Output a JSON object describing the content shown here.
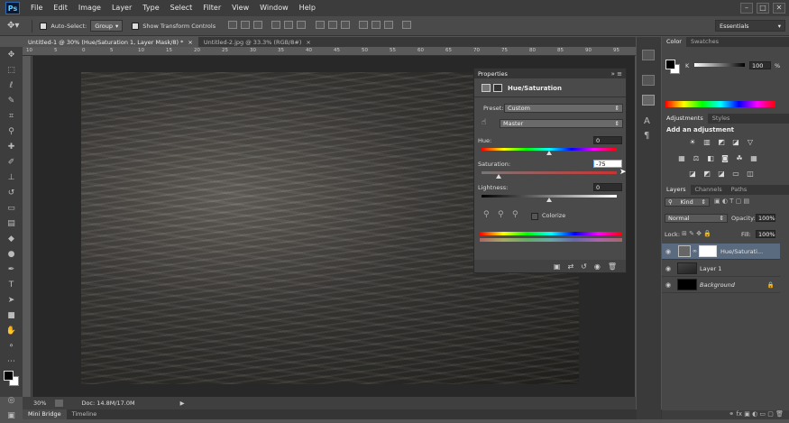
{
  "app": {
    "logo": "Ps",
    "essentials": "Essentials",
    "window_controls": [
      "–",
      "□",
      "✕"
    ]
  },
  "menu": [
    "File",
    "Edit",
    "Image",
    "Layer",
    "Type",
    "Select",
    "Filter",
    "View",
    "Window",
    "Help"
  ],
  "options": {
    "auto_select_label": "Auto-Select:",
    "auto_select_value": "Group",
    "transform_label": "Show Transform Controls"
  },
  "tabs": [
    {
      "label": "Untitled-1 @ 30% (Hue/Saturation 1, Layer Mask/8) *",
      "close": "×"
    },
    {
      "label": "Untitled-2.jpg @ 33.3% (RGB/8#)",
      "close": "×"
    }
  ],
  "ruler_marks": [
    "10",
    "5",
    "0",
    "5",
    "10",
    "15",
    "20",
    "25",
    "30",
    "35",
    "40",
    "45",
    "50",
    "55",
    "60",
    "65",
    "70",
    "75",
    "80",
    "85",
    "90",
    "95"
  ],
  "properties": {
    "title": "Properties",
    "panel_name": "Hue/Saturation",
    "preset_label": "Preset:",
    "preset_value": "Custom",
    "channel_value": "Master",
    "hue_label": "Hue:",
    "hue_value": "0",
    "saturation_label": "Saturation:",
    "saturation_value": "-75",
    "lightness_label": "Lightness:",
    "lightness_value": "0",
    "colorize_label": "Colorize",
    "hue_fraction": 0.5,
    "saturation_fraction": 0.125,
    "lightness_fraction": 0.5
  },
  "status": {
    "zoom": "30%",
    "doc": "Doc: 14.8M/17.0M"
  },
  "bottom_tabs": [
    "Mini Bridge",
    "Timeline"
  ],
  "right": {
    "color_tabs": [
      "Color",
      "Swatches"
    ],
    "k_label": "K",
    "k_value": "100",
    "k_unit": "%",
    "adj_tabs": [
      "Adjustments",
      "Styles"
    ],
    "adj_title": "Add an adjustment",
    "layers_tabs": [
      "Layers",
      "Channels",
      "Paths"
    ],
    "kind_value": "Kind",
    "blend_mode": "Normal",
    "opacity_label": "Opacity:",
    "opacity_value": "100%",
    "lock_label": "Lock:",
    "fill_label": "Fill:",
    "fill_value": "100%",
    "layers": [
      {
        "name": "Hue/Saturati..."
      },
      {
        "name": "Layer 1"
      },
      {
        "name": "Background"
      }
    ]
  },
  "colors": {
    "accent_selected_layer": "#5a6b80",
    "hue_bar": "rainbow",
    "saturation_bar_end": "#cc3333"
  }
}
